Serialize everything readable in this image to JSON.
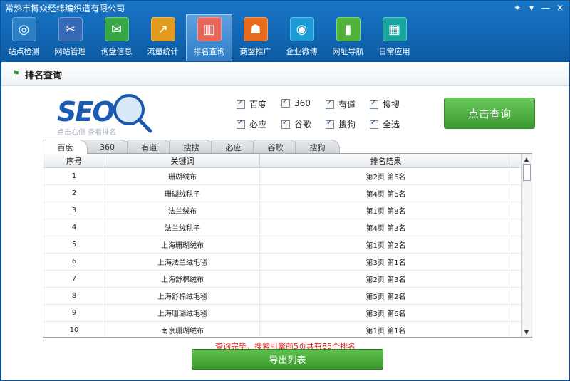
{
  "window": {
    "title": "常熟市博众经纬编织造有限公司",
    "controls": [
      "✦",
      "▾",
      "—",
      "✕"
    ]
  },
  "toolbar": [
    {
      "label": "站点检测",
      "icon": "radar-icon",
      "color": "#2b7fc7",
      "glyph": "◎"
    },
    {
      "label": "网站管理",
      "icon": "tools-icon",
      "color": "#3568b5",
      "glyph": "✂"
    },
    {
      "label": "询盘信息",
      "icon": "chat-icon",
      "color": "#35a745",
      "glyph": "✉"
    },
    {
      "label": "流量统计",
      "icon": "trend-chart-icon",
      "color": "#e09a1d",
      "glyph": "↗"
    },
    {
      "label": "排名查询",
      "icon": "bar-chart-icon",
      "color": "#e8655a",
      "glyph": "▥",
      "active": true
    },
    {
      "label": "商盟推广",
      "icon": "users-icon",
      "color": "#e86b1d",
      "glyph": "☗"
    },
    {
      "label": "企业微博",
      "icon": "weibo-icon",
      "color": "#1a9bd6",
      "glyph": "◉"
    },
    {
      "label": "网址导航",
      "icon": "mouse-icon",
      "color": "#4fb33a",
      "glyph": "▮"
    },
    {
      "label": "日常应用",
      "icon": "apps-grid-icon",
      "color": "#17a6a0",
      "glyph": "▦"
    }
  ],
  "page": {
    "title": "排名查询",
    "logo_text": "SEO",
    "logo_sub": "点击右侧 查看排名"
  },
  "engines": [
    {
      "label": "百度",
      "checked": true
    },
    {
      "label": "360",
      "checked": true
    },
    {
      "label": "有道",
      "checked": true
    },
    {
      "label": "搜搜",
      "checked": true
    },
    {
      "label": "必应",
      "checked": true
    },
    {
      "label": "谷歌",
      "checked": true
    },
    {
      "label": "搜狗",
      "checked": true
    },
    {
      "label": "全选",
      "checked": true
    }
  ],
  "query_button": "点击查询",
  "tabs": [
    "百度",
    "360",
    "有道",
    "搜搜",
    "必应",
    "谷歌",
    "搜狗"
  ],
  "table": {
    "headers": [
      "序号",
      "关键词",
      "排名结果"
    ],
    "rows": [
      [
        "1",
        "珊瑚绒布",
        "第2页 第6名"
      ],
      [
        "2",
        "珊瑚绒毯子",
        "第4页 第6名"
      ],
      [
        "3",
        "法兰绒布",
        "第1页 第8名"
      ],
      [
        "4",
        "法兰绒毯子",
        "第4页 第3名"
      ],
      [
        "5",
        "上海珊瑚绒布",
        "第1页 第2名"
      ],
      [
        "6",
        "上海法兰绒毛毯",
        "第3页 第1名"
      ],
      [
        "7",
        "上海舒棉绒布",
        "第2页 第3名"
      ],
      [
        "8",
        "上海舒棉绒毛毯",
        "第5页 第2名"
      ],
      [
        "9",
        "上海珊瑚绒毛毯",
        "第3页 第6名"
      ],
      [
        "10",
        "南京珊瑚绒布",
        "第1页 第1名"
      ]
    ]
  },
  "status_text": "查询完毕，搜索引擎前5页共有85个排名",
  "export_button": "导出列表"
}
